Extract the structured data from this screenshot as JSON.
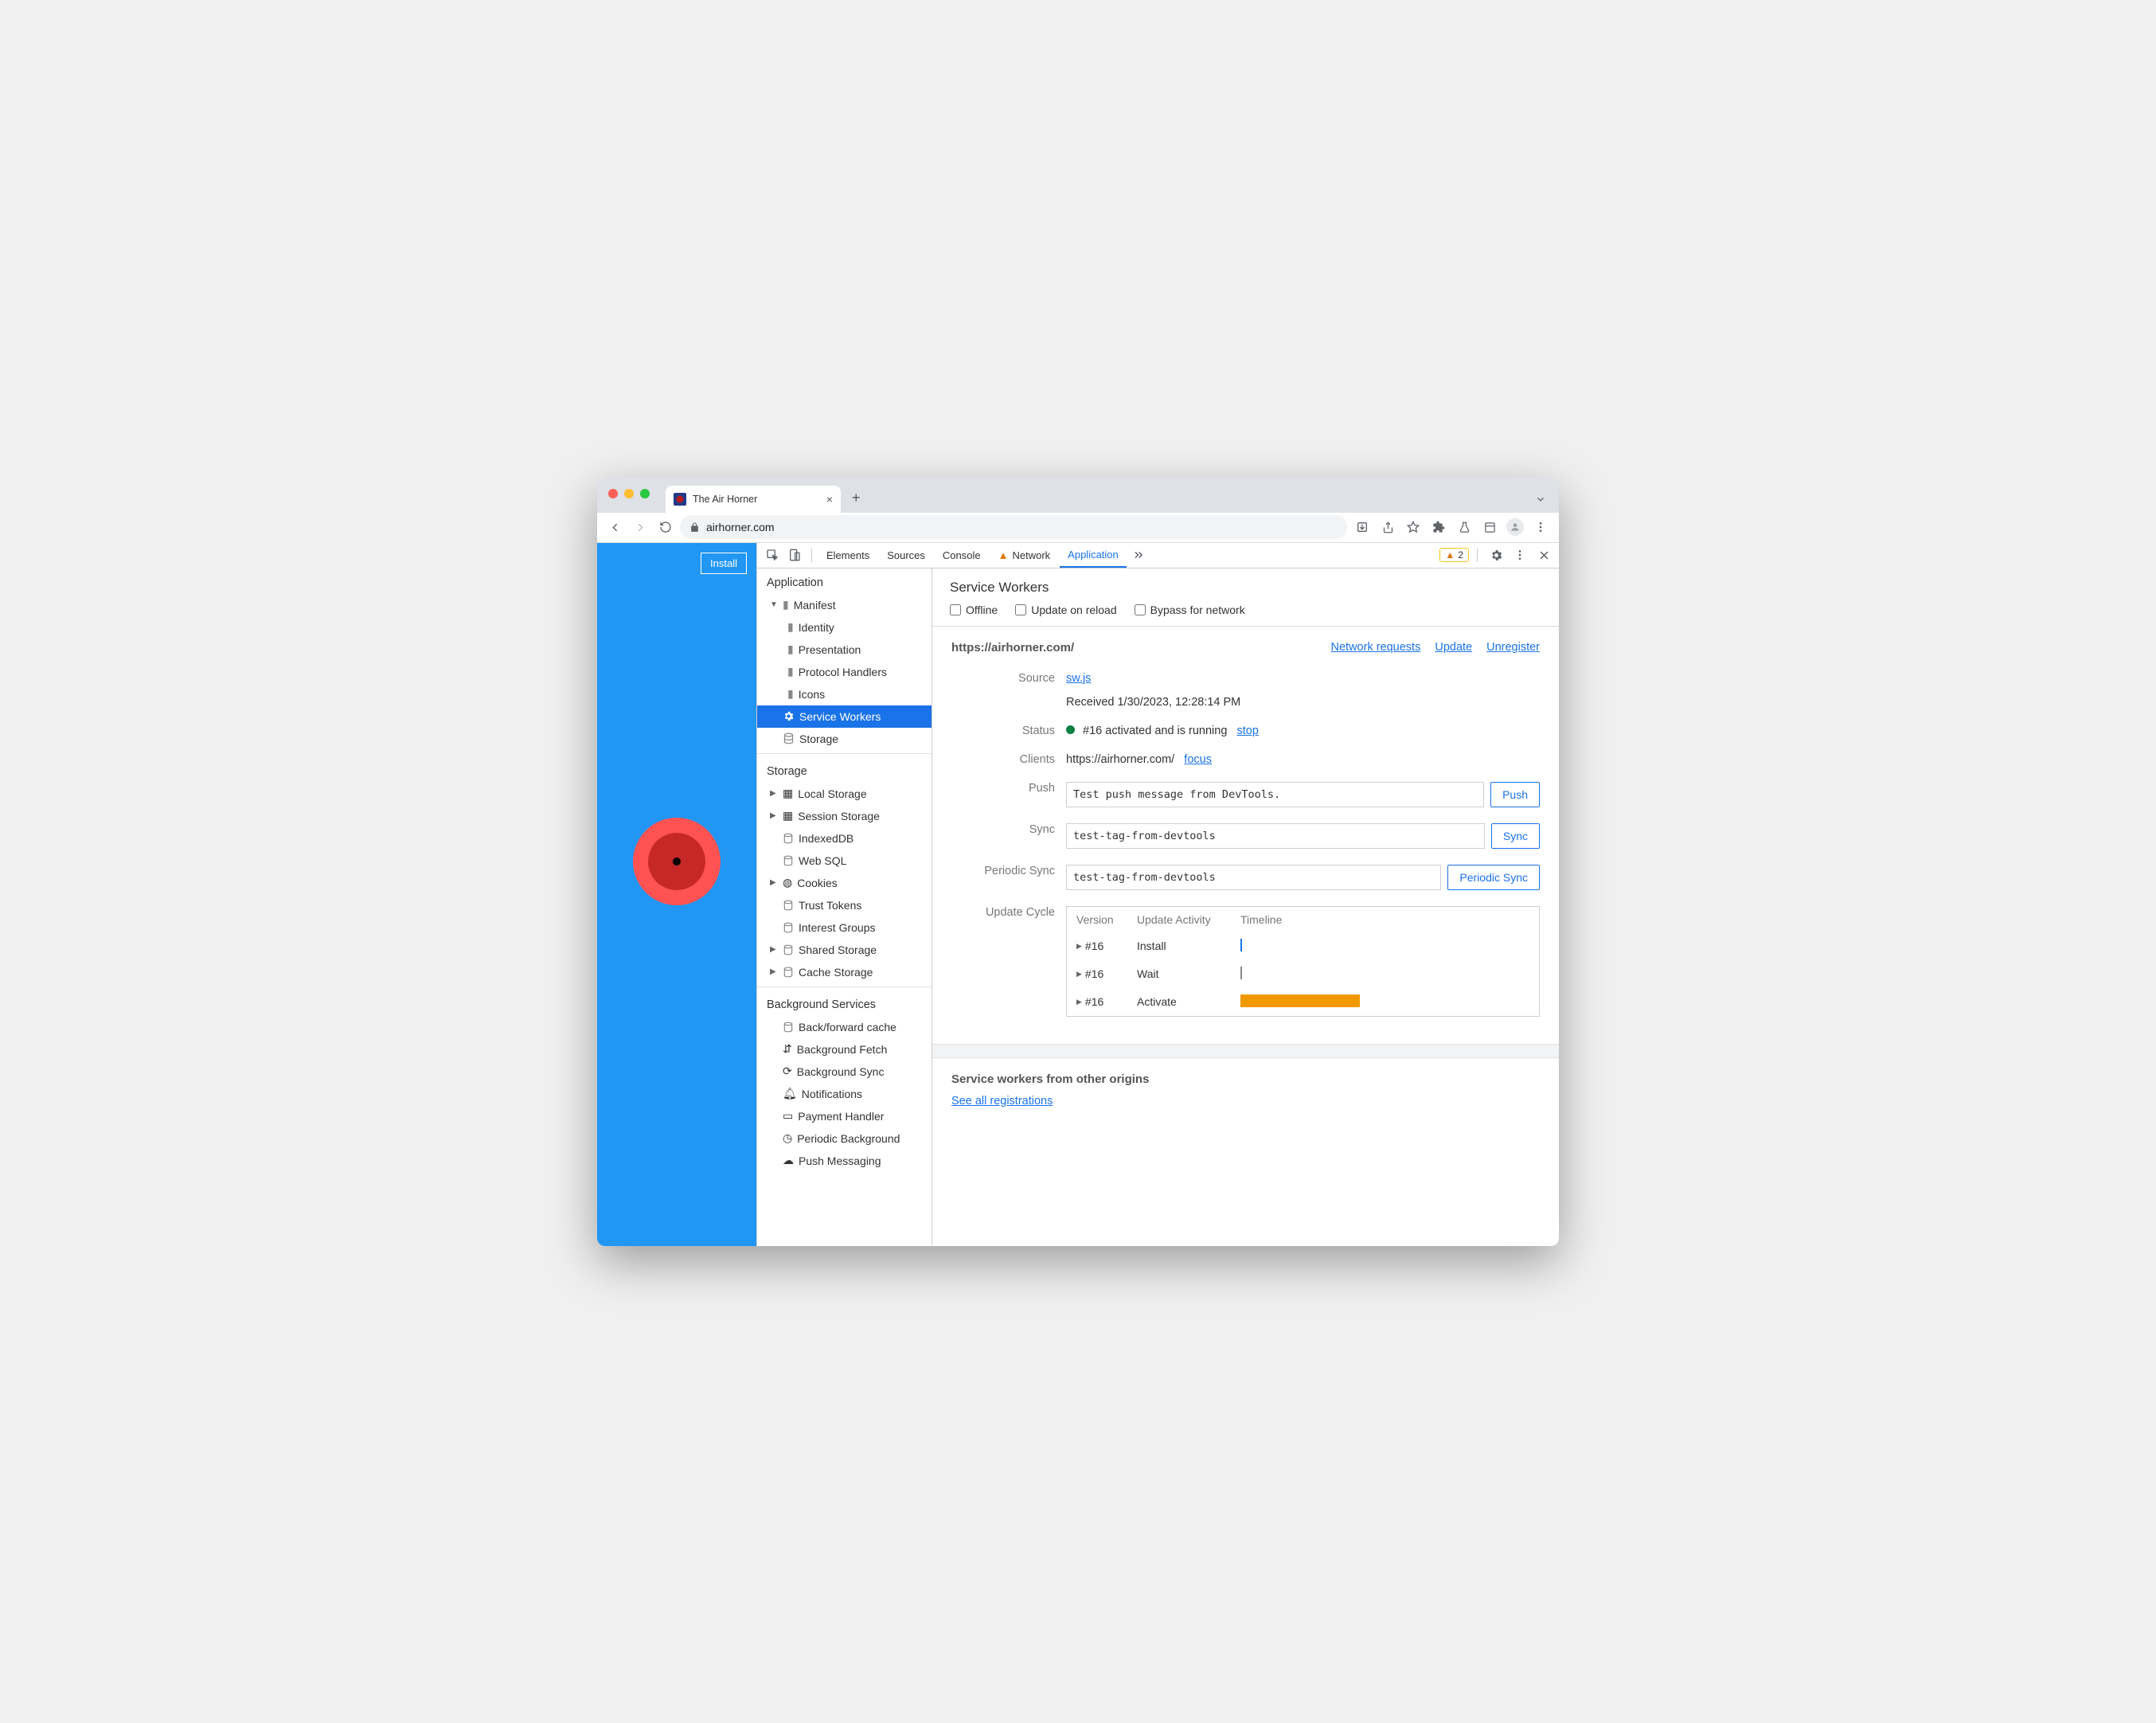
{
  "browser": {
    "tab_title": "The Air Horner",
    "url": "airhorner.com",
    "install_label": "Install"
  },
  "devtools": {
    "tabs": {
      "elements": "Elements",
      "sources": "Sources",
      "console": "Console",
      "network": "Network",
      "application": "Application"
    },
    "warning_count": "2"
  },
  "sidebar": {
    "app_header": "Application",
    "manifest": "Manifest",
    "identity": "Identity",
    "presentation": "Presentation",
    "protocol_handlers": "Protocol Handlers",
    "icons": "Icons",
    "service_workers": "Service Workers",
    "storage": "Storage",
    "storage_header": "Storage",
    "local_storage": "Local Storage",
    "session_storage": "Session Storage",
    "indexeddb": "IndexedDB",
    "web_sql": "Web SQL",
    "cookies": "Cookies",
    "trust_tokens": "Trust Tokens",
    "interest_groups": "Interest Groups",
    "shared_storage": "Shared Storage",
    "cache_storage": "Cache Storage",
    "bg_header": "Background Services",
    "back_forward": "Back/forward cache",
    "bg_fetch": "Background Fetch",
    "bg_sync": "Background Sync",
    "notifications": "Notifications",
    "payment_handler": "Payment Handler",
    "periodic_bg": "Periodic Background",
    "push_messaging": "Push Messaging"
  },
  "sw": {
    "title": "Service Workers",
    "offline": "Offline",
    "update_on_reload": "Update on reload",
    "bypass": "Bypass for network",
    "scope_url": "https://airhorner.com/",
    "network_requests": "Network requests",
    "update": "Update",
    "unregister": "Unregister",
    "source_label": "Source",
    "source_file": "sw.js",
    "received": "Received 1/30/2023, 12:28:14 PM",
    "status_label": "Status",
    "status_text": "#16 activated and is running",
    "stop": "stop",
    "clients_label": "Clients",
    "clients_url": "https://airhorner.com/",
    "focus": "focus",
    "push_label": "Push",
    "push_value": "Test push message from DevTools.",
    "push_btn": "Push",
    "sync_label": "Sync",
    "sync_value": "test-tag-from-devtools",
    "sync_btn": "Sync",
    "periodic_label": "Periodic Sync",
    "periodic_value": "test-tag-from-devtools",
    "periodic_btn": "Periodic Sync",
    "uc_label": "Update Cycle",
    "uc_version": "Version",
    "uc_activity": "Update Activity",
    "uc_timeline": "Timeline",
    "uc_v1": "#16",
    "uc_a1": "Install",
    "uc_v2": "#16",
    "uc_a2": "Wait",
    "uc_v3": "#16",
    "uc_a3": "Activate",
    "other_title": "Service workers from other origins",
    "see_all": "See all registrations"
  }
}
